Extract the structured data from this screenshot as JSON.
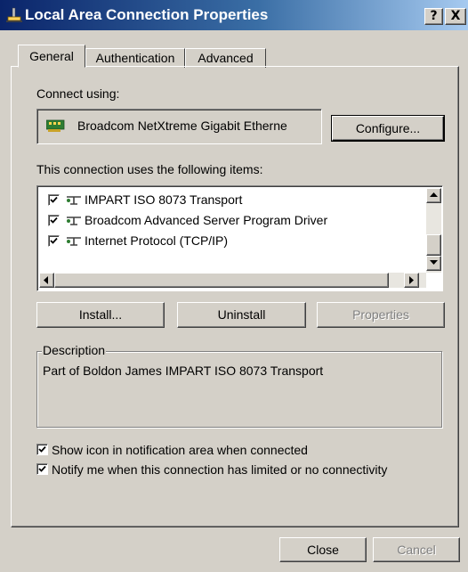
{
  "window": {
    "title": "Local Area Connection Properties",
    "help_button": "?",
    "close_button": "X",
    "title_color_start": "#0a246a",
    "title_color_end": "#a6caf0"
  },
  "tabs": [
    {
      "label": "General",
      "active": true
    },
    {
      "label": "Authentication",
      "active": false
    },
    {
      "label": "Advanced",
      "active": false
    }
  ],
  "connect_using": {
    "label": "Connect using:",
    "adapter": "Broadcom NetXtreme Gigabit Etherne",
    "adapter_icon": "network-card-icon",
    "configure_button": "Configure..."
  },
  "items": {
    "label": "This connection uses the following items:",
    "list": [
      {
        "label": "IMPART ISO 8073 Transport",
        "checked": true,
        "icon": "network-protocol-icon"
      },
      {
        "label": "Broadcom Advanced Server Program Driver",
        "checked": true,
        "icon": "network-protocol-icon"
      },
      {
        "label": "Internet Protocol (TCP/IP)",
        "checked": true,
        "icon": "network-protocol-icon"
      }
    ]
  },
  "buttons": {
    "install": "Install...",
    "uninstall": "Uninstall",
    "properties": "Properties",
    "properties_enabled": false
  },
  "description": {
    "legend": "Description",
    "text": "Part of Boldon James IMPART ISO 8073 Transport"
  },
  "options": [
    {
      "label": "Show icon in notification area when connected",
      "checked": true
    },
    {
      "label": "Notify me when this connection has limited or no connectivity",
      "checked": true
    }
  ],
  "footer": {
    "close": "Close",
    "cancel": "Cancel",
    "cancel_enabled": false
  }
}
